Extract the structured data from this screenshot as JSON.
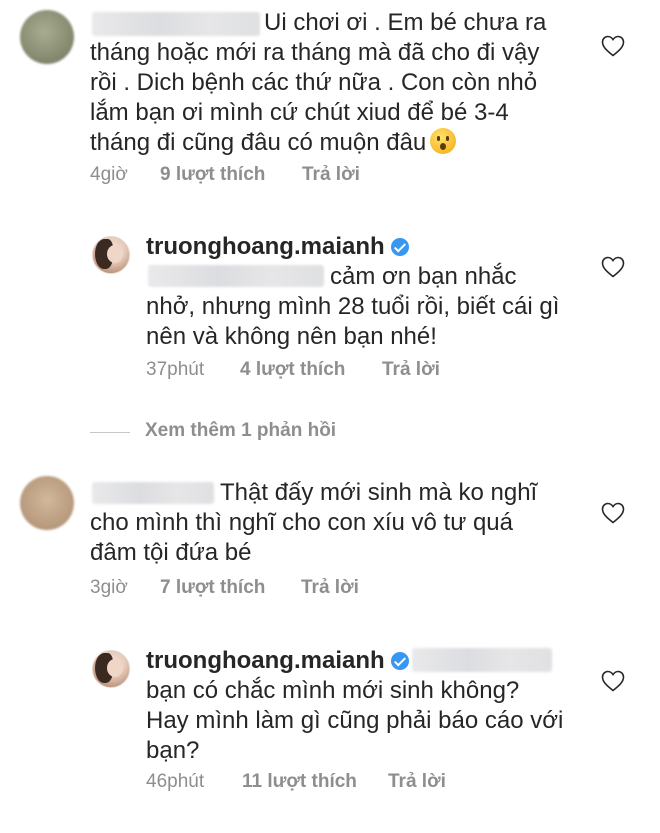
{
  "comments": [
    {
      "text_lines": [
        "Ui chơi ơi . Em bé chưa ra",
        "tháng hoặc mới ra tháng mà đã cho đi vậy",
        "rồi . Dich bệnh các thứ nữa . Con còn nhỏ",
        "lắm bạn ơi mình cứ chút xiud để bé 3-4",
        "tháng đi cũng đâu có muộn đâu"
      ],
      "emoji_icon": "astonished-face-emoji",
      "time": "4giờ",
      "likes": "9 lượt thích",
      "reply": "Trả lời"
    },
    {
      "username": "truonghoang.maianh",
      "text_lines": [
        "cảm ơn bạn nhắc",
        "nhở, nhưng mình 28 tuổi rồi, biết cái gì",
        "nên và không nên bạn nhé!"
      ],
      "time": "37phút",
      "likes": "4 lượt thích",
      "reply": "Trả lời"
    },
    {
      "text_lines": [
        "Thật đấy mới sinh mà ko nghĩ",
        "cho mình thì nghĩ cho con xíu vô tư quá",
        "đâm tội đứa bé"
      ],
      "time": "3giờ",
      "likes": "7 lượt thích",
      "reply": "Trả lời"
    },
    {
      "username": "truonghoang.maianh",
      "text_lines": [
        "bạn có chắc mình mới sinh không?",
        "Hay mình làm gì cũng phải báo cáo với",
        "bạn?"
      ],
      "time": "46phút",
      "likes": "11 lượt thích",
      "reply": "Trả lời"
    }
  ],
  "view_more": "Xem thêm 1 phản hồi",
  "icons": {
    "like": "heart-outline-icon",
    "verified": "verified-badge-icon"
  },
  "colors": {
    "text": "#262626",
    "meta": "#8e8e8e",
    "verified": "#3897f0"
  }
}
